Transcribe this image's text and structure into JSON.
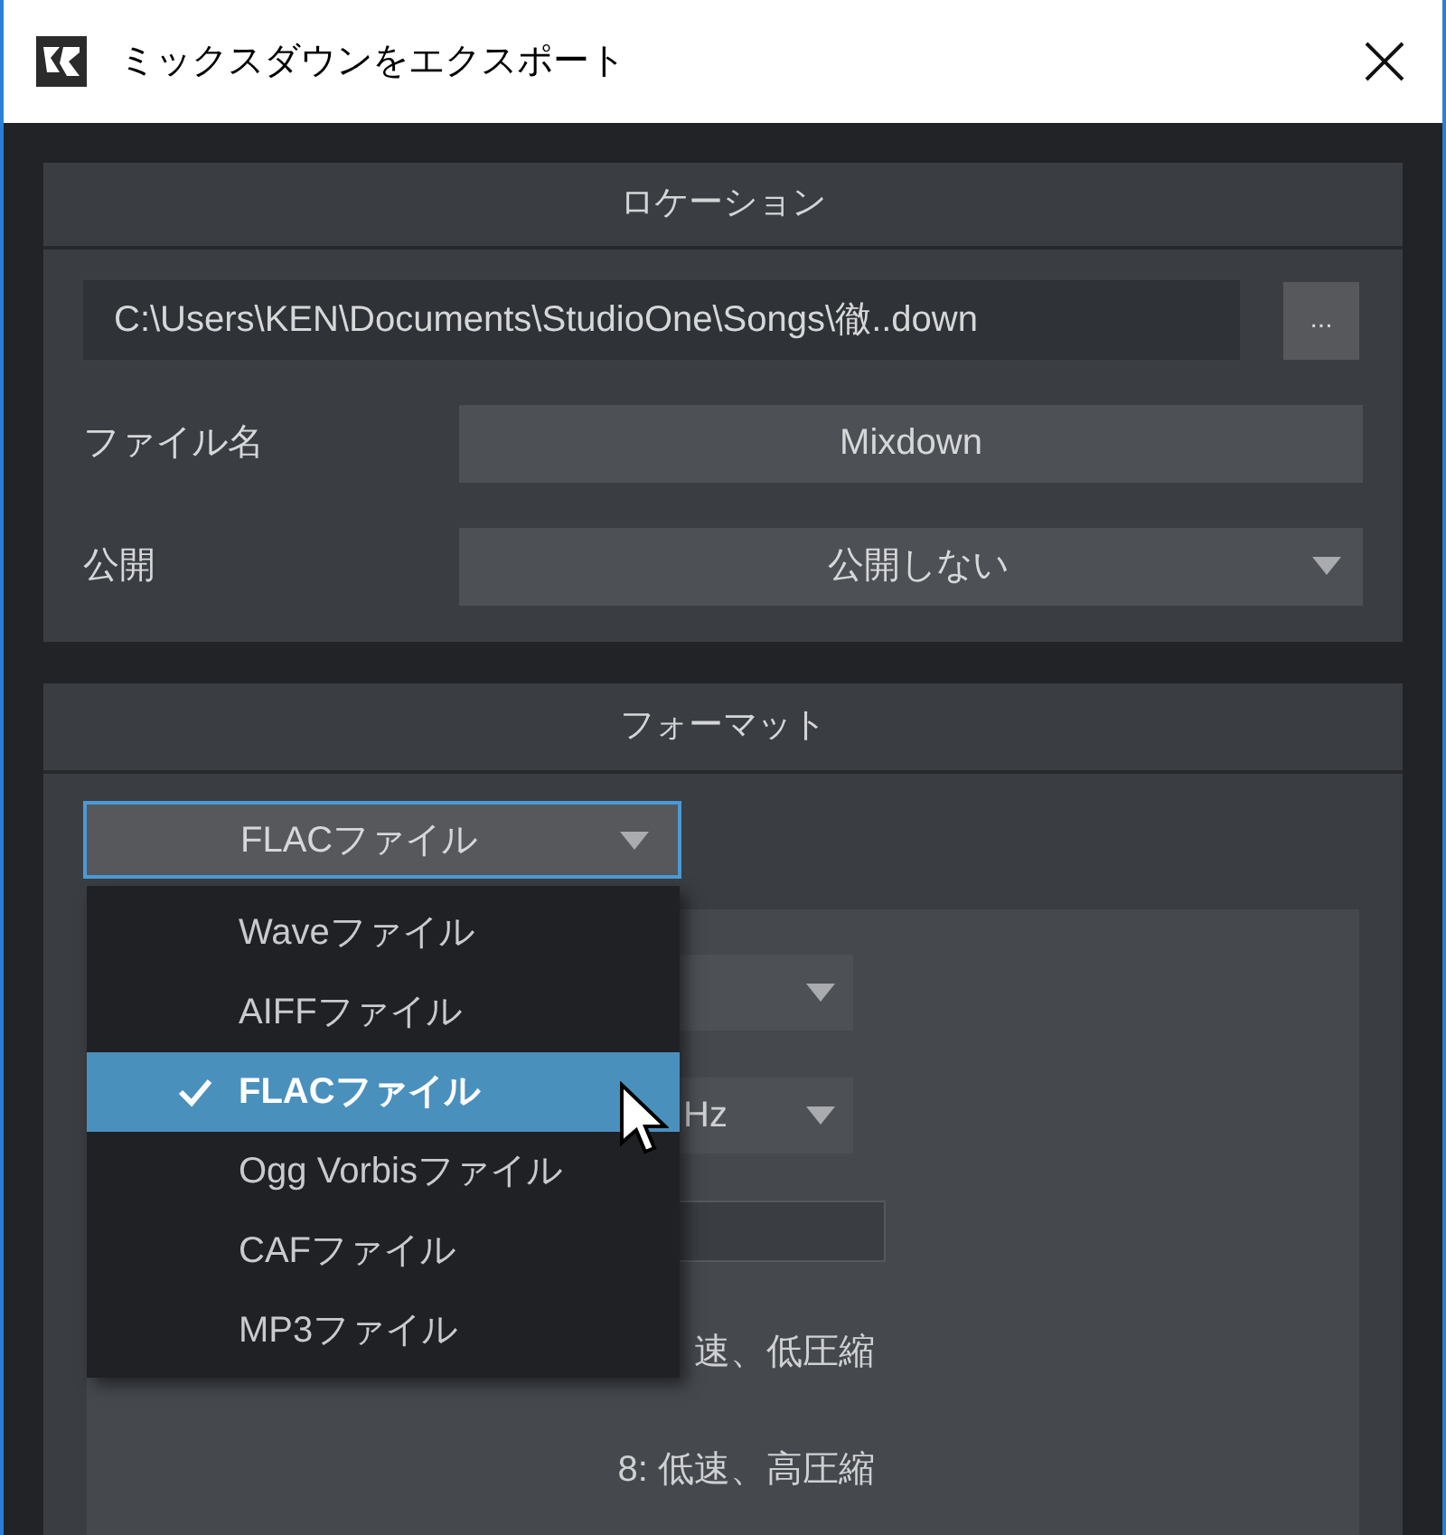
{
  "window": {
    "title": "ミックスダウンをエクスポート"
  },
  "location": {
    "title": "ロケーション",
    "path": "C:\\Users\\KEN\\Documents\\StudioOne\\Songs\\徹..down",
    "browse_button": "...",
    "fields": [
      {
        "kind": "text",
        "label": "ファイル名",
        "value": "Mixdown"
      },
      {
        "kind": "dropdown",
        "label": "公開",
        "value": "公開しない"
      }
    ]
  },
  "format": {
    "title": "フォーマット",
    "type_dropdown": {
      "value": "FLACファイル",
      "expanded": true
    },
    "menu": [
      {
        "label": "Waveファイル",
        "selected": false
      },
      {
        "label": "AIFFファイル",
        "selected": false
      },
      {
        "label": "FLACファイル",
        "selected": true
      },
      {
        "label": "Ogg Vorbisファイル",
        "selected": false
      },
      {
        "label": "CAFファイル",
        "selected": false
      },
      {
        "label": "MP3ファイル",
        "selected": false
      }
    ],
    "settings": [
      {
        "kind": "dropdown"
      },
      {
        "kind": "dropdown",
        "value": "Hz"
      },
      {
        "kind": "field"
      },
      {
        "kind": "text",
        "value": "速、低圧縮"
      },
      {
        "kind": "text",
        "value": "8: 低速、高圧縮"
      }
    ]
  }
}
